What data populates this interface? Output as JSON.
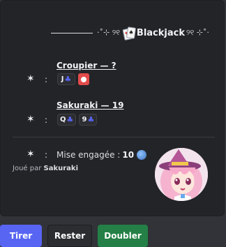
{
  "embed": {
    "title": {
      "deco_left": "·˚⊹ ୨୧",
      "text": "Blackjack",
      "deco_right": "୨୧ ⊹˚·"
    },
    "dealer": {
      "star": "✶",
      "colon": ":",
      "label": "Croupier — ?",
      "cards": [
        {
          "rank": "J",
          "suit": "♣"
        }
      ],
      "hidden_card": true
    },
    "player": {
      "star": "✶",
      "colon": ":",
      "label": "Sakuraki — 19",
      "cards": [
        {
          "rank": "Q",
          "suit": "♣"
        },
        {
          "rank": "9",
          "suit": "♣"
        }
      ]
    },
    "bet": {
      "star": "✶",
      "colon": ":",
      "label": "Mise engagée :",
      "amount": "10"
    },
    "footer": {
      "prefix": "Joué par",
      "user": "Sakuraki"
    }
  },
  "buttons": {
    "hit": "Tirer",
    "stand": "Rester",
    "double": "Doubler"
  },
  "colors": {
    "primary": "#5865f2",
    "secondary": "#2b2d31",
    "success": "#248046",
    "embed_bg": "#232428"
  }
}
